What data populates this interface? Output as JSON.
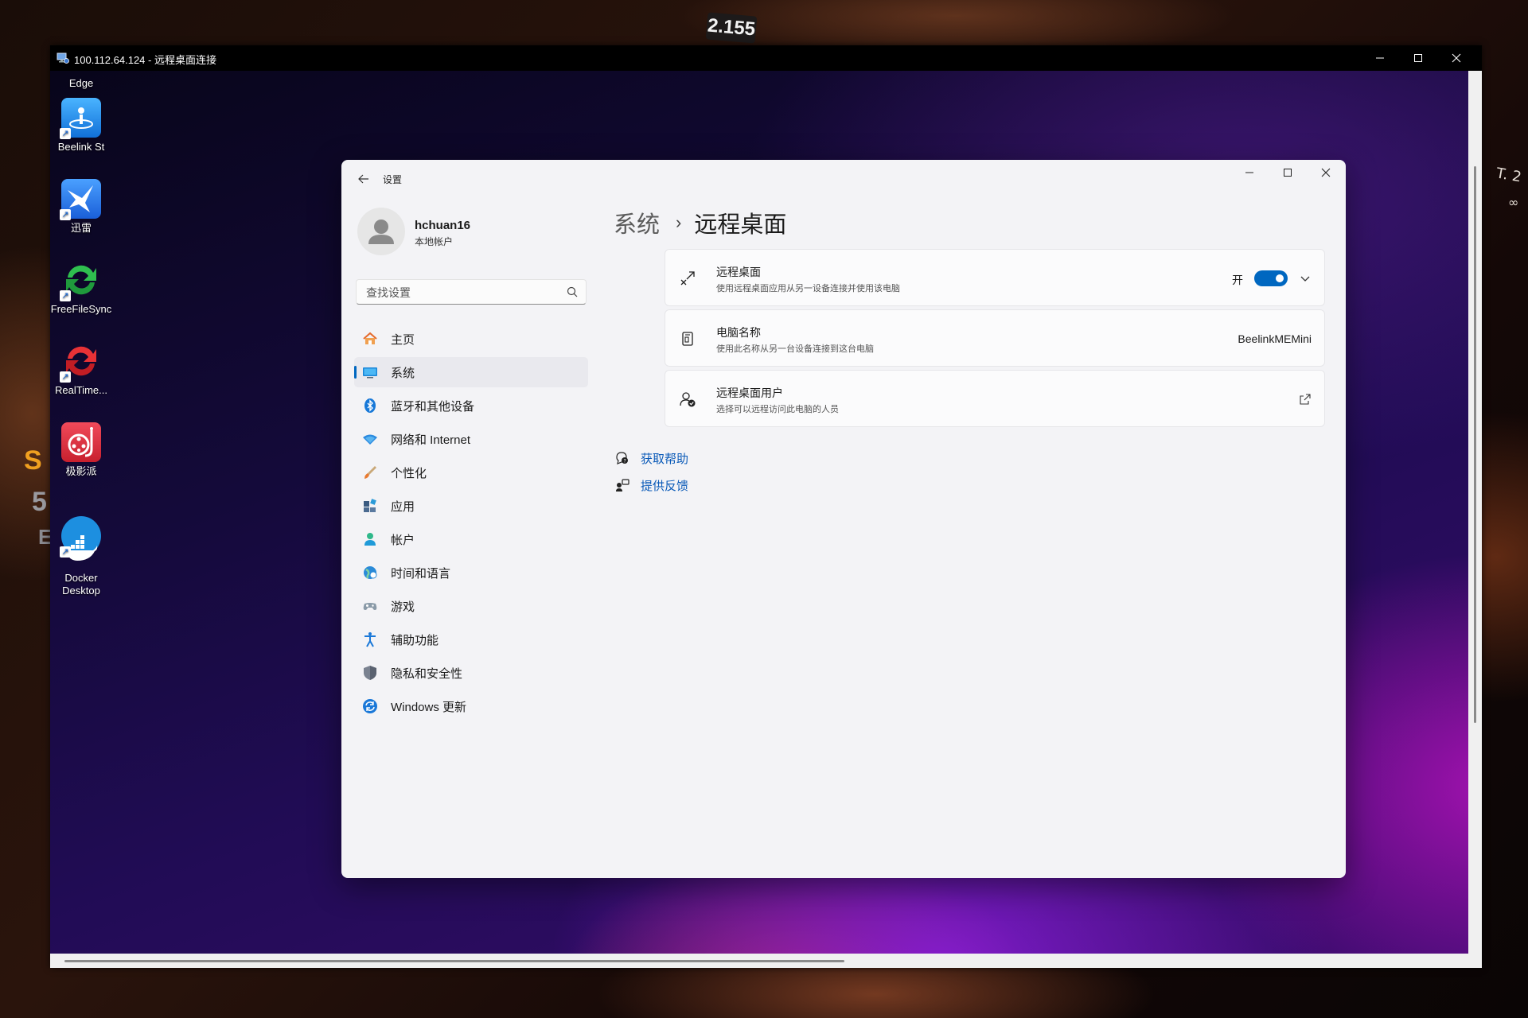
{
  "host": {
    "badge": "2.155",
    "edge_glyphs": "T. 2",
    "edge_symbol": "∞",
    "left_glyphs": [
      "S",
      "5",
      "E"
    ]
  },
  "rdp_window": {
    "title": "100.112.64.124 - 远程桌面连接"
  },
  "desktop": {
    "top_label": "Edge",
    "icons": [
      {
        "label": "Beelink St",
        "icon": "beelink-icon",
        "color": "#1e8fe8"
      },
      {
        "label": "迅雷",
        "icon": "thunder-icon",
        "color": "#2f7fe8"
      },
      {
        "label": "FreeFileSync",
        "icon": "freefilesync-icon",
        "color": "#2aa84a"
      },
      {
        "label": "RealTime...",
        "icon": "realtimesync-icon",
        "color": "#d8282c"
      },
      {
        "label": "极影派",
        "icon": "jiyingpai-icon",
        "color": "#d83040"
      },
      {
        "label": "Docker\nDesktop",
        "icon": "docker-icon",
        "color": "#1d8fe0"
      }
    ]
  },
  "settings": {
    "app_title": "设置",
    "user": {
      "name": "hchuan16",
      "account_type": "本地帐户"
    },
    "search": {
      "placeholder": "查找设置"
    },
    "nav": [
      {
        "label": "主页",
        "icon": "home-icon"
      },
      {
        "label": "系统",
        "icon": "system-icon",
        "active": true
      },
      {
        "label": "蓝牙和其他设备",
        "icon": "bluetooth-icon"
      },
      {
        "label": "网络和 Internet",
        "icon": "network-icon"
      },
      {
        "label": "个性化",
        "icon": "personalization-icon"
      },
      {
        "label": "应用",
        "icon": "apps-icon"
      },
      {
        "label": "帐户",
        "icon": "accounts-icon"
      },
      {
        "label": "时间和语言",
        "icon": "time-language-icon"
      },
      {
        "label": "游戏",
        "icon": "gaming-icon"
      },
      {
        "label": "辅助功能",
        "icon": "accessibility-icon"
      },
      {
        "label": "隐私和安全性",
        "icon": "privacy-icon"
      },
      {
        "label": "Windows 更新",
        "icon": "windows-update-icon"
      }
    ],
    "breadcrumb": {
      "parent": "系统",
      "separator": "›",
      "current": "远程桌面"
    },
    "cards": {
      "remote_desktop": {
        "title": "远程桌面",
        "description": "使用远程桌面应用从另一设备连接并使用该电脑",
        "toggle_state": "开",
        "toggle_on": true
      },
      "pc_name": {
        "title": "电脑名称",
        "description": "使用此名称从另一台设备连接到这台电脑",
        "value": "BeelinkMEMini"
      },
      "remote_users": {
        "title": "远程桌面用户",
        "description": "选择可以远程访问此电脑的人员"
      }
    },
    "links": {
      "help": "获取帮助",
      "feedback": "提供反馈"
    },
    "accent_color": "#0067c0"
  }
}
